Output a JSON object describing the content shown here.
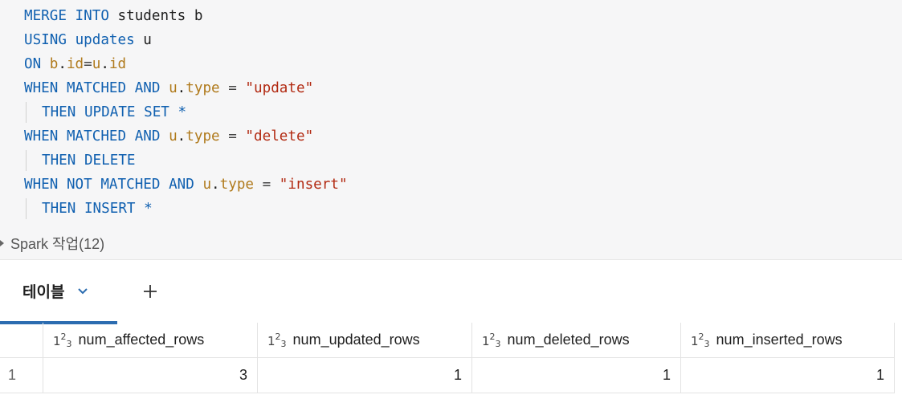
{
  "code_lines": [
    [
      {
        "t": "MERGE INTO ",
        "c": "kw"
      },
      {
        "t": "students b",
        "c": "plain"
      }
    ],
    [
      {
        "t": "USING ",
        "c": "kw"
      },
      {
        "t": "updates",
        "c": "kw"
      },
      {
        "t": " u",
        "c": "plain"
      }
    ],
    [
      {
        "t": "ON ",
        "c": "kw"
      },
      {
        "t": "b",
        "c": "id"
      },
      {
        "t": ".",
        "c": "plain"
      },
      {
        "t": "id",
        "c": "id"
      },
      {
        "t": "=",
        "c": "op"
      },
      {
        "t": "u",
        "c": "id"
      },
      {
        "t": ".",
        "c": "plain"
      },
      {
        "t": "id",
        "c": "id"
      }
    ],
    [
      {
        "t": "WHEN MATCHED AND ",
        "c": "kw"
      },
      {
        "t": "u",
        "c": "id"
      },
      {
        "t": ".",
        "c": "plain"
      },
      {
        "t": "type",
        "c": "id"
      },
      {
        "t": " = ",
        "c": "op"
      },
      {
        "t": "\"update\"",
        "c": "str"
      }
    ],
    [
      {
        "t": "THEN UPDATE SET *",
        "c": "kw",
        "indent": true
      }
    ],
    [
      {
        "t": "WHEN MATCHED AND ",
        "c": "kw"
      },
      {
        "t": "u",
        "c": "id"
      },
      {
        "t": ".",
        "c": "plain"
      },
      {
        "t": "type",
        "c": "id"
      },
      {
        "t": " = ",
        "c": "op"
      },
      {
        "t": "\"delete\"",
        "c": "str"
      }
    ],
    [
      {
        "t": "THEN DELETE",
        "c": "kw",
        "indent": true
      }
    ],
    [
      {
        "t": "WHEN NOT MATCHED AND ",
        "c": "kw"
      },
      {
        "t": "u",
        "c": "id"
      },
      {
        "t": ".",
        "c": "plain"
      },
      {
        "t": "type",
        "c": "id"
      },
      {
        "t": " = ",
        "c": "op"
      },
      {
        "t": "\"insert\"",
        "c": "str"
      }
    ],
    [
      {
        "t": "THEN INSERT *",
        "c": "kw",
        "indent": true
      }
    ]
  ],
  "spark_jobs": {
    "label": "Spark 작업(12)"
  },
  "tabs": [
    {
      "label": "테이블",
      "active": true
    }
  ],
  "add_tab_icon": "plus-icon",
  "table": {
    "type_icon": {
      "base": "1",
      "sup": "2",
      "sub": "3"
    },
    "columns": [
      "num_affected_rows",
      "num_updated_rows",
      "num_deleted_rows",
      "num_inserted_rows"
    ],
    "rows": [
      {
        "index": "1",
        "values": [
          "3",
          "1",
          "1",
          "1"
        ]
      }
    ]
  },
  "colors": {
    "keyword": "#1060b0",
    "identifier": "#b07a1c",
    "string": "#b22a12",
    "accent": "#2b6cb0"
  }
}
